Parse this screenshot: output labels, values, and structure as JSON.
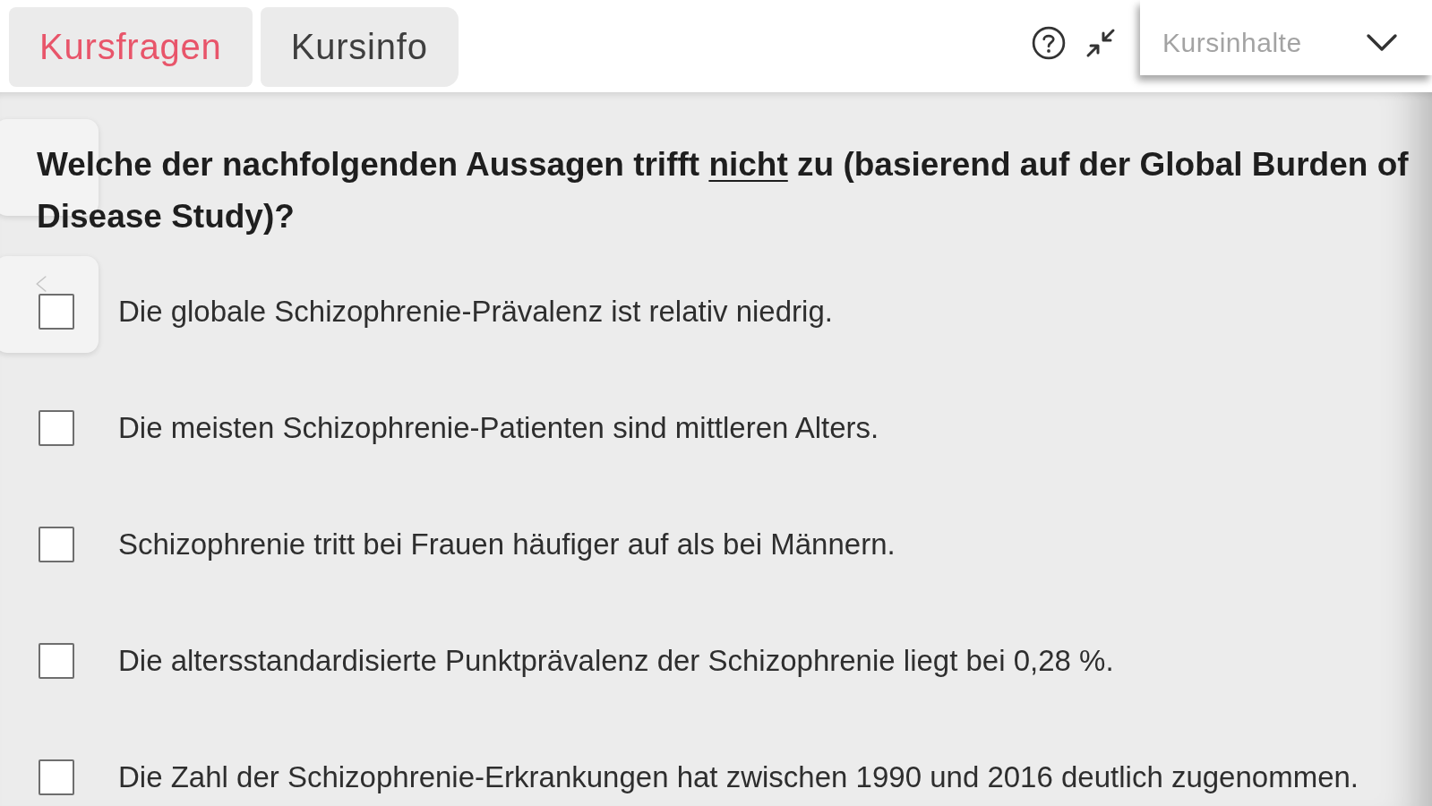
{
  "tabs": [
    {
      "label": "Kursfragen",
      "selected": true
    },
    {
      "label": "Kursinfo",
      "selected": false
    }
  ],
  "course_contents_dropdown": {
    "placeholder": "Kursinhalte"
  },
  "question": {
    "segments": [
      {
        "text": "Welche der nachfolgenden Aussagen trifft ",
        "underline": false
      },
      {
        "text": "nicht",
        "underline": true
      },
      {
        "text": " zu (basierend auf der Global Burden of Disease Study)?",
        "underline": false
      }
    ]
  },
  "answers": [
    {
      "text": "Die globale Schizophrenie-Prävalenz ist relativ niedrig.",
      "checked": false
    },
    {
      "text": "Die meisten Schizophrenie-Patienten sind mittleren Alters.",
      "checked": false
    },
    {
      "text": "Schizophrenie tritt bei Frauen häufiger auf als bei Männern.",
      "checked": false
    },
    {
      "text": "Die altersstandardisierte Punktprävalenz der Schizophrenie liegt bei 0,28 %.",
      "checked": false
    },
    {
      "text": "Die Zahl der Schizophrenie-Erkrankungen hat zwischen 1990 und 2016 deutlich zugenommen.",
      "checked": false
    }
  ]
}
